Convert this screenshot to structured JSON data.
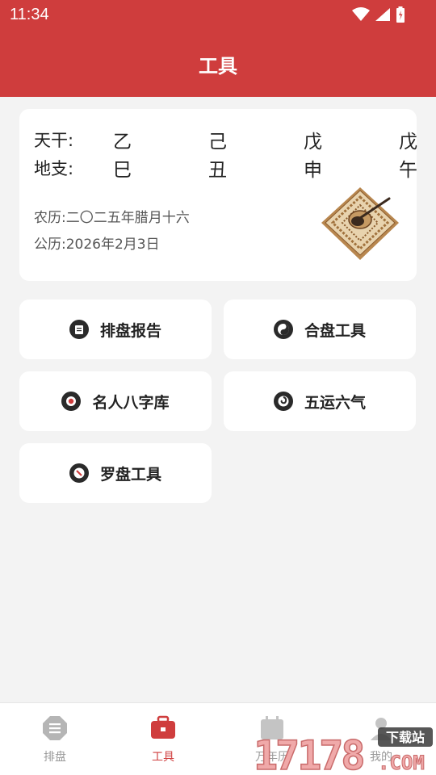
{
  "status_bar": {
    "time": "11:34",
    "icons": [
      "wifi-icon",
      "cell-signal-icon",
      "battery-icon"
    ]
  },
  "header": {
    "title": "工具"
  },
  "bazi": {
    "tiangan_label": "天干:",
    "dizhi_label": "地支:",
    "tiangan": [
      "乙",
      "己",
      "戊",
      "戊"
    ],
    "dizhi": [
      "巳",
      "丑",
      "申",
      "午"
    ],
    "lunar": "农历:二〇二五年腊月十六",
    "solar": "公历:2026年2月3日"
  },
  "tools": [
    {
      "label": "排盘报告",
      "icon": "report-icon"
    },
    {
      "label": "合盘工具",
      "icon": "yin-yang-icon"
    },
    {
      "label": "名人八字库",
      "icon": "celebrity-icon"
    },
    {
      "label": "五运六气",
      "icon": "spiral-icon"
    },
    {
      "label": "罗盘工具",
      "icon": "compass-icon"
    }
  ],
  "bottom_nav": [
    {
      "label": "排盘",
      "icon": "paipan-icon",
      "active": false
    },
    {
      "label": "工具",
      "icon": "toolbox-icon",
      "active": true
    },
    {
      "label": "万年历",
      "icon": "calendar-icon",
      "active": false
    },
    {
      "label": "我的",
      "icon": "profile-icon",
      "active": false
    }
  ],
  "watermark": {
    "text": "17178",
    "suffix": ".COM",
    "tag": "下载站"
  },
  "colors": {
    "primary": "#cf3d3d",
    "background": "#f3f3f3",
    "card": "#ffffff",
    "inactive": "#9a9a9a"
  }
}
